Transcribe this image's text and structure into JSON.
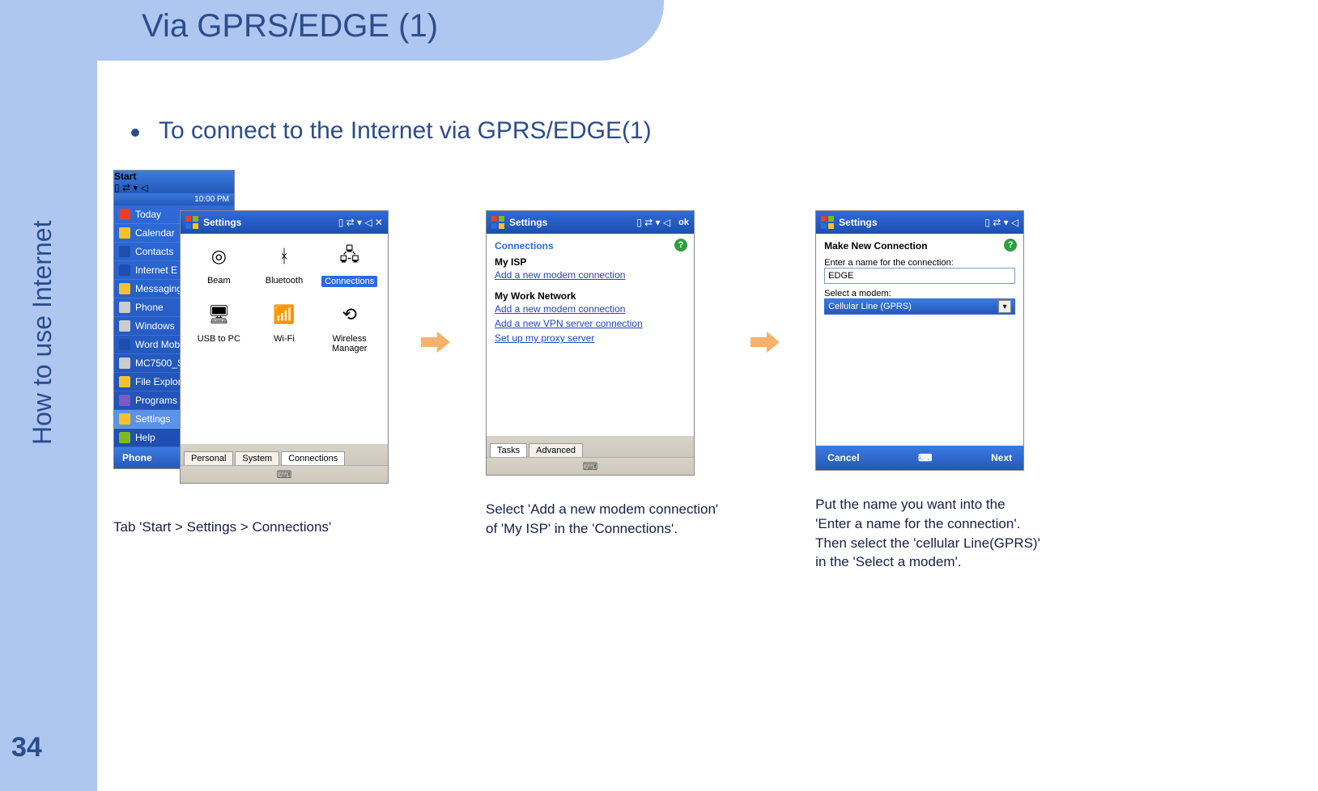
{
  "slide": {
    "title": "Via GPRS/EDGE (1)",
    "side_title": "How to use Internet",
    "page_number": "34",
    "bullet": "To connect to the Internet via GPRS/EDGE(1)"
  },
  "captions": {
    "c1": "Tab 'Start > Settings > Connections'",
    "c2_l1": "Select 'Add a new modem connection'",
    "c2_l2": "of 'My ISP' in the 'Connections'.",
    "c3_l1": "Put the name you want into the",
    "c3_l2": " 'Enter a name for the connection'.",
    "c3_l3": "Then select the 'cellular Line(GPRS)'",
    "c3_l4": "in the 'Select a modem'."
  },
  "shot1": {
    "start_title": "Start",
    "time": "10:00 PM",
    "menu": [
      "Today",
      "Calendar",
      "Contacts",
      "Internet E",
      "Messaging",
      "Phone",
      "Windows",
      "Word Mob",
      "MC7500_S",
      "File Explor",
      "Programs",
      "Settings",
      "Help"
    ],
    "phone": "Phone",
    "settings_title": "Settings",
    "icons": [
      {
        "label": "Beam",
        "glyph": "◎"
      },
      {
        "label": "Bluetooth",
        "glyph": "ᚼ"
      },
      {
        "label": "Connections",
        "glyph": "🖧",
        "sel": true
      },
      {
        "label": "USB to PC",
        "glyph": "🖥"
      },
      {
        "label": "Wi-Fi",
        "glyph": "📶"
      },
      {
        "label": "Wireless Manager",
        "glyph": "⟲"
      }
    ],
    "tabs": [
      "Personal",
      "System",
      "Connections"
    ]
  },
  "shot2": {
    "title": "Settings",
    "ok": "ok",
    "section": "Connections",
    "myisp": "My ISP",
    "myisp_link": "Add a new modem connection",
    "mywork": "My Work Network",
    "work_links": [
      "Add a new modem connection",
      "Add a new VPN server connection",
      "Set up my proxy server"
    ],
    "tabs": [
      "Tasks",
      "Advanced"
    ]
  },
  "shot3": {
    "title": "Settings",
    "section": "Make New Connection",
    "name_label": "Enter a name for the connection:",
    "name_value": "EDGE",
    "modem_label": "Select a modem:",
    "modem_value": "Cellular Line (GPRS)",
    "cancel": "Cancel",
    "next": "Next"
  }
}
